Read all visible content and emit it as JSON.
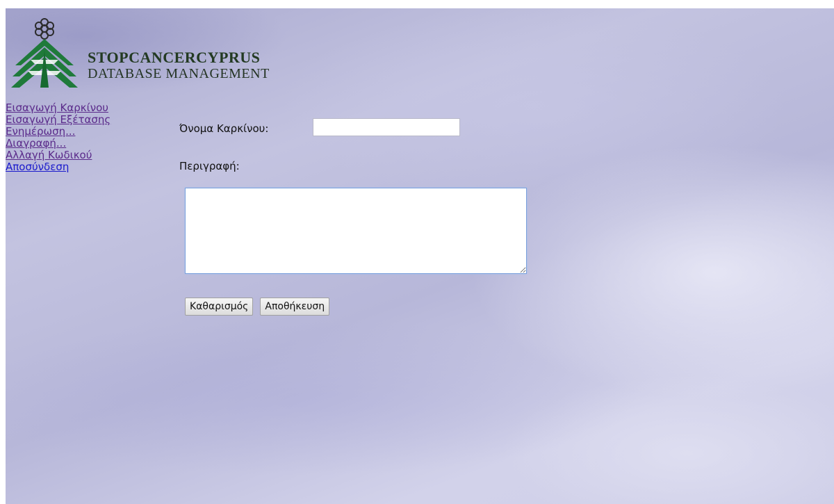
{
  "logo": {
    "line1": "STOPCANCERCYPRUS",
    "line2": "DATABASE MANAGEMENT"
  },
  "nav": {
    "items": [
      {
        "label": "Εισαγωγή Καρκίνου"
      },
      {
        "label": "Εισαγωγή Εξέτασης"
      },
      {
        "label": "Ενημέρωση..."
      },
      {
        "label": "Διαγραφή..."
      },
      {
        "label": "Αλλαγή Κωδικού"
      },
      {
        "label": "Αποσύνδεση"
      }
    ]
  },
  "form": {
    "name_label": "Όνομα Καρκίνου:",
    "name_value": "",
    "description_label": "Περιγραφή:",
    "description_value": "",
    "clear_label": "Καθαρισμός",
    "save_label": "Αποθήκευση"
  },
  "colors": {
    "visited_link": "#5a2a8a",
    "link": "#1a1acc",
    "logo_green": "#1f7a3a"
  }
}
